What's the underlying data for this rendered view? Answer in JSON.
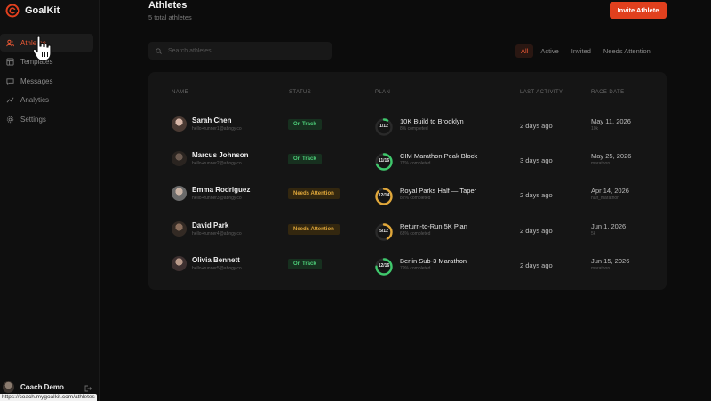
{
  "app": {
    "name": "GoalKit",
    "accent": "#e1401e"
  },
  "sidebar": {
    "items": [
      {
        "label": "Athletes",
        "icon": "users-icon",
        "active": true
      },
      {
        "label": "Templates",
        "icon": "template-icon",
        "active": false
      },
      {
        "label": "Messages",
        "icon": "message-icon",
        "active": false
      },
      {
        "label": "Analytics",
        "icon": "chart-icon",
        "active": false
      },
      {
        "label": "Settings",
        "icon": "gear-icon",
        "active": false
      }
    ],
    "user": {
      "name": "Coach Demo"
    }
  },
  "status_url": "https://coach.mygoalkit.com/athletes",
  "header": {
    "title": "Athletes",
    "subtitle": "5 total athletes",
    "invite_label": "Invite Athlete"
  },
  "search": {
    "placeholder": "Search athletes...",
    "value": ""
  },
  "filters": [
    {
      "label": "All",
      "active": true
    },
    {
      "label": "Active",
      "active": false
    },
    {
      "label": "Invited",
      "active": false
    },
    {
      "label": "Needs Attention",
      "active": false
    }
  ],
  "table": {
    "columns": [
      "NAME",
      "STATUS",
      "PLAN",
      "LAST ACTIVITY",
      "RACE DATE"
    ],
    "rows": [
      {
        "name": "Sarah Chen",
        "email": "hello+runner1@abngy.co",
        "status": "On Track",
        "status_kind": "ontrack",
        "week": "1/12",
        "progress": 0.08,
        "ring_color": "#3fc86c",
        "plan": "10K Build to Brooklyn",
        "plan_progress": "8% completed",
        "last_activity": "2 days ago",
        "race_date": "May 11, 2026",
        "race_type": "10k"
      },
      {
        "name": "Marcus Johnson",
        "email": "hello+runner2@abngy.co",
        "status": "On Track",
        "status_kind": "ontrack",
        "week": "11/16",
        "progress": 0.69,
        "ring_color": "#3fc86c",
        "plan": "CIM Marathon Peak Block",
        "plan_progress": "77% completed",
        "last_activity": "3 days ago",
        "race_date": "May 25, 2026",
        "race_type": "marathon"
      },
      {
        "name": "Emma Rodriguez",
        "email": "hello+runner3@abngy.co",
        "status": "Needs Attention",
        "status_kind": "attention",
        "week": "12/14",
        "progress": 0.86,
        "ring_color": "#e0a73a",
        "plan": "Royal Parks Half — Taper",
        "plan_progress": "82% completed",
        "last_activity": "2 days ago",
        "race_date": "Apr 14, 2026",
        "race_type": "half_marathon"
      },
      {
        "name": "David Park",
        "email": "hello+runner4@abngy.co",
        "status": "Needs Attention",
        "status_kind": "attention",
        "week": "5/12",
        "progress": 0.42,
        "ring_color": "#e0a73a",
        "plan": "Return-to-Run 5K Plan",
        "plan_progress": "63% completed",
        "last_activity": "2 days ago",
        "race_date": "Jun 1, 2026",
        "race_type": "5k"
      },
      {
        "name": "Olivia Bennett",
        "email": "hello+runner5@abngy.co",
        "status": "On Track",
        "status_kind": "ontrack",
        "week": "12/16",
        "progress": 0.75,
        "ring_color": "#3fc86c",
        "plan": "Berlin Sub-3 Marathon",
        "plan_progress": "79% completed",
        "last_activity": "2 days ago",
        "race_date": "Jun 15, 2026",
        "race_type": "marathon"
      }
    ]
  }
}
